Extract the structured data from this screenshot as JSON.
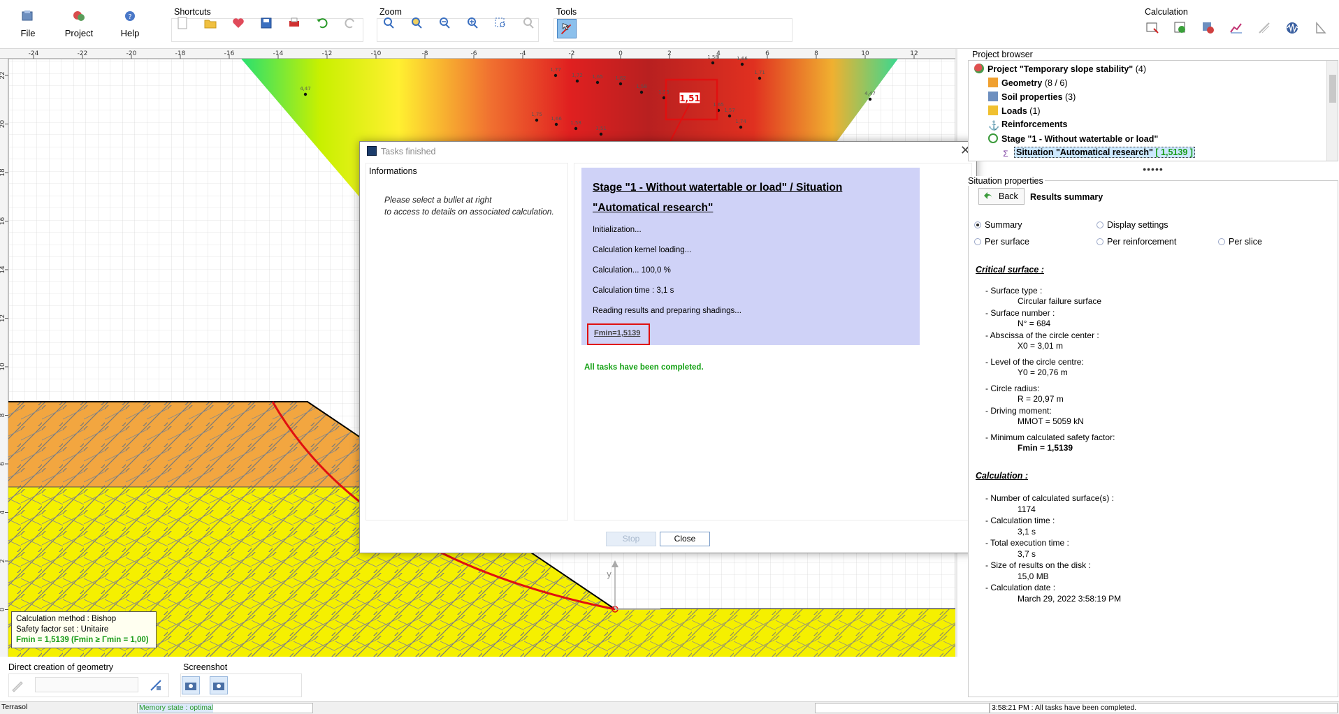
{
  "ribbon": {
    "file_label": "File",
    "project_label": "Project",
    "help_label": "Help",
    "shortcuts_label": "Shortcuts",
    "zoom_label": "Zoom",
    "tools_label": "Tools",
    "calculation_label": "Calculation"
  },
  "canvas": {
    "x_ticks": [
      "-24",
      "-22",
      "-20",
      "-18",
      "-16",
      "-14",
      "-12",
      "-10",
      "-8",
      "-6",
      "-4",
      "-2",
      "0",
      "2",
      "4",
      "6",
      "8",
      "10",
      "12"
    ],
    "y_ticks": [
      "22",
      "20",
      "18",
      "16",
      "14",
      "12",
      "10",
      "8",
      "6",
      "4",
      "2",
      "0"
    ],
    "marker_label": "1,51",
    "point_labels": [
      "4,47",
      "1,77",
      "1,72",
      "1,65",
      "1,62",
      "1,58",
      "1,55",
      "1,58",
      "1,66",
      "1,71",
      "4,47",
      "1,75",
      "1,66",
      "1,58",
      "1,51",
      "1,57",
      "1,65",
      "1,74"
    ],
    "axis_y_label": "y"
  },
  "calc_info": {
    "method": "Calculation method : Bishop",
    "safety_set": "Safety factor set : Unitaire",
    "fmin": "Fmin = 1,5139 (Fmin ≥ Γmin = 1,00)"
  },
  "dialog": {
    "title": "Tasks finished",
    "info_heading": "Informations",
    "info_line1": "Please select a bullet at right",
    "info_line2": "to access to details on associated calculation.",
    "stage_title": "Stage \"1 - Without watertable or load\" / Situation \"Automatical research\"",
    "steps": [
      "Initialization...",
      "Calculation kernel loading...",
      "Calculation... 100,0 %",
      "Calculation time : 3,1 s",
      "Reading results and preparing shadings..."
    ],
    "fmin": "Fmin=1,5139",
    "completed": "All tasks have been completed.",
    "stop_label": "Stop",
    "close_label": "Close"
  },
  "browser": {
    "label": "Project browser",
    "project": "Project \"Temporary slope stability\"",
    "project_count": "(4)",
    "geometry": "Geometry",
    "geometry_count": "(8 / 6)",
    "soil": "Soil properties",
    "soil_count": "(3)",
    "loads": "Loads",
    "loads_count": "(1)",
    "reinforcements": "Reinforcements",
    "stage": "Stage \"1 - Without watertable or load\"",
    "situation": "Situation \"Automatical research\"",
    "situation_value": "[ 1,5139 ]"
  },
  "props": {
    "label": "Situation properties",
    "back_label": "Back",
    "results_summary": "Results summary",
    "radio_summary": "Summary",
    "radio_display": "Display settings",
    "radio_surface": "Per surface",
    "radio_reinforcement": "Per reinforcement",
    "radio_slice": "Per slice",
    "critical_head": "Critical surface :",
    "surface_type_l": "- Surface type :",
    "surface_type_v": "Circular failure surface",
    "surface_number_l": "- Surface number :",
    "surface_number_v": "N° = 684",
    "abscissa_l": "- Abscissa of the circle center :",
    "abscissa_v": "X0 = 3,01 m",
    "level_l": "- Level of the circle centre:",
    "level_v": "Y0 = 20,76 m",
    "radius_l": "- Circle radius:",
    "radius_v": "R = 20,97 m",
    "moment_l": "- Driving moment:",
    "moment_v": "MMOT = 5059 kN",
    "minfactor_l": "- Minimum calculated safety factor:",
    "minfactor_v": "Fmin = 1,5139",
    "calc_head": "Calculation :",
    "num_surfaces_l": "- Number of calculated surface(s) :",
    "num_surfaces_v": "1174",
    "calc_time_l": "- Calculation time :",
    "calc_time_v": "3,1 s",
    "exec_time_l": "- Total execution time :",
    "exec_time_v": "3,7 s",
    "size_l": "- Size of results on the disk :",
    "size_v": "15,0 MB",
    "date_l": "- Calculation date :",
    "date_v": "March 29, 2022 3:58:19 PM"
  },
  "bottom": {
    "direct_label": "Direct creation of geometry",
    "screenshot_label": "Screenshot"
  },
  "status": {
    "app": "Terrasol",
    "memory": "Memory state : optimal",
    "message": "3:58:21 PM : All tasks have been completed."
  }
}
